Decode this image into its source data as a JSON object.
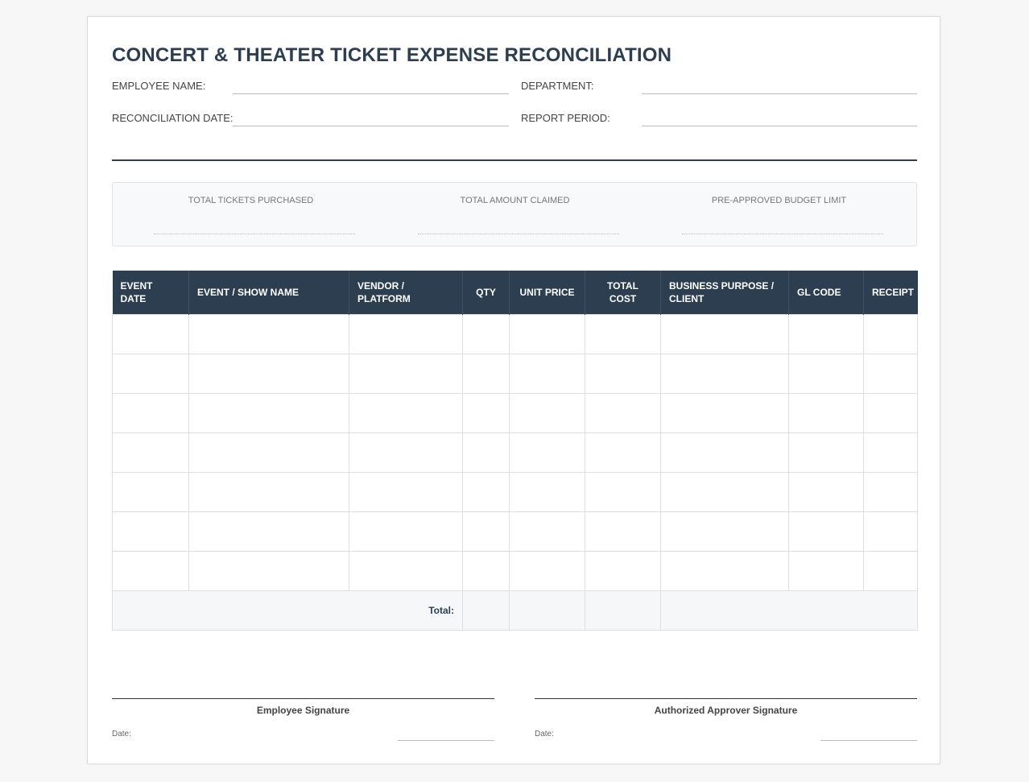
{
  "title": "CONCERT & THEATER TICKET EXPENSE RECONCILIATION",
  "fields": {
    "employee_name_label": "EMPLOYEE NAME:",
    "department_label": "DEPARTMENT:",
    "reconciliation_date_label": "RECONCILIATION DATE:",
    "report_period_label": "REPORT PERIOD:"
  },
  "summary": {
    "total_tickets_label": "TOTAL TICKETS PURCHASED",
    "total_amount_label": "TOTAL AMOUNT CLAIMED",
    "budget_limit_label": "PRE-APPROVED BUDGET LIMIT"
  },
  "table": {
    "headers": [
      "EVENT DATE",
      "EVENT / SHOW NAME",
      "VENDOR / PLATFORM",
      "QTY",
      "UNIT PRICE",
      "TOTAL COST",
      "BUSINESS PURPOSE / CLIENT",
      "GL CODE",
      "RECEIPT"
    ],
    "total_label": "Total:"
  },
  "signatures": {
    "employee_label": "Employee Signature",
    "approver_label": "Authorized Approver Signature",
    "date_label": "Date:"
  },
  "colors": {
    "header_bg": "#2c3e50",
    "accent": "#2c3e50"
  }
}
